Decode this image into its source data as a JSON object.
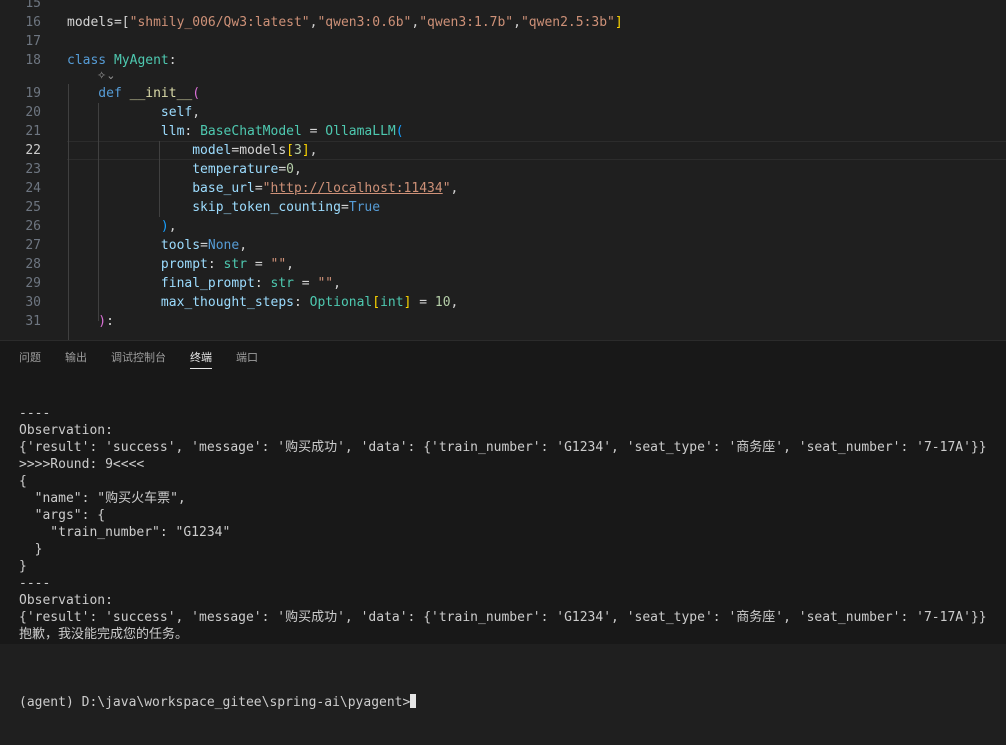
{
  "editor": {
    "lines": [
      {
        "num": "15",
        "tokens": []
      },
      {
        "num": "16",
        "tokens": [
          {
            "t": "models=[",
            "c": "w"
          },
          {
            "t": "\"shmily_006/Qw3:latest\"",
            "c": "s"
          },
          {
            "t": ",",
            "c": "w"
          },
          {
            "t": "\"qwen3:0.6b\"",
            "c": "s"
          },
          {
            "t": ",",
            "c": "w"
          },
          {
            "t": "\"qwen3:1.7b\"",
            "c": "s"
          },
          {
            "t": ",",
            "c": "w"
          },
          {
            "t": "\"qwen2.5:3b\"",
            "c": "s"
          },
          {
            "t": "]",
            "c": "br1"
          }
        ]
      },
      {
        "num": "17",
        "tokens": []
      },
      {
        "num": "18",
        "tokens": [
          {
            "t": "class ",
            "c": "k"
          },
          {
            "t": "MyAgent",
            "c": "cls"
          },
          {
            "t": ":",
            "c": "w"
          }
        ]
      },
      {
        "num": "19",
        "tokens": [
          {
            "t": "    def ",
            "c": "k"
          },
          {
            "t": "__init__",
            "c": "fn"
          },
          {
            "t": "(",
            "c": "br2"
          }
        ]
      },
      {
        "num": "20",
        "tokens": [
          {
            "t": "            self",
            "c": "p"
          },
          {
            "t": ",",
            "c": "w"
          }
        ]
      },
      {
        "num": "21",
        "tokens": [
          {
            "t": "            llm",
            "c": "p"
          },
          {
            "t": ": ",
            "c": "w"
          },
          {
            "t": "BaseChatModel",
            "c": "cls"
          },
          {
            "t": " = ",
            "c": "w"
          },
          {
            "t": "OllamaLLM",
            "c": "cls"
          },
          {
            "t": "(",
            "c": "br3"
          }
        ]
      },
      {
        "num": "22",
        "tokens": [
          {
            "t": "                model",
            "c": "p"
          },
          {
            "t": "=models",
            "c": "w"
          },
          {
            "t": "[",
            "c": "br1"
          },
          {
            "t": "3",
            "c": "n"
          },
          {
            "t": "]",
            "c": "br1"
          },
          {
            "t": ",",
            "c": "w"
          }
        ]
      },
      {
        "num": "23",
        "tokens": [
          {
            "t": "                temperature",
            "c": "p"
          },
          {
            "t": "=",
            "c": "w"
          },
          {
            "t": "0",
            "c": "n"
          },
          {
            "t": ",",
            "c": "w"
          }
        ]
      },
      {
        "num": "24",
        "tokens": [
          {
            "t": "                base_url",
            "c": "p"
          },
          {
            "t": "=",
            "c": "w"
          },
          {
            "t": "\"",
            "c": "s"
          },
          {
            "t": "http://localhost:11434",
            "c": "s url"
          },
          {
            "t": "\"",
            "c": "s"
          },
          {
            "t": ",",
            "c": "w"
          }
        ]
      },
      {
        "num": "25",
        "tokens": [
          {
            "t": "                skip_token_counting",
            "c": "p"
          },
          {
            "t": "=",
            "c": "w"
          },
          {
            "t": "True",
            "c": "k"
          }
        ]
      },
      {
        "num": "26",
        "tokens": [
          {
            "t": "            )",
            "c": "br3"
          },
          {
            "t": ",",
            "c": "w"
          }
        ]
      },
      {
        "num": "27",
        "tokens": [
          {
            "t": "            tools",
            "c": "p"
          },
          {
            "t": "=",
            "c": "w"
          },
          {
            "t": "None",
            "c": "k"
          },
          {
            "t": ",",
            "c": "w"
          }
        ]
      },
      {
        "num": "28",
        "tokens": [
          {
            "t": "            prompt",
            "c": "p"
          },
          {
            "t": ": ",
            "c": "w"
          },
          {
            "t": "str",
            "c": "cls"
          },
          {
            "t": " = ",
            "c": "w"
          },
          {
            "t": "\"\"",
            "c": "s"
          },
          {
            "t": ",",
            "c": "w"
          }
        ]
      },
      {
        "num": "29",
        "tokens": [
          {
            "t": "            final_prompt",
            "c": "p"
          },
          {
            "t": ": ",
            "c": "w"
          },
          {
            "t": "str",
            "c": "cls"
          },
          {
            "t": " = ",
            "c": "w"
          },
          {
            "t": "\"\"",
            "c": "s"
          },
          {
            "t": ",",
            "c": "w"
          }
        ]
      },
      {
        "num": "30",
        "tokens": [
          {
            "t": "            max_thought_steps",
            "c": "p"
          },
          {
            "t": ": ",
            "c": "w"
          },
          {
            "t": "Optional",
            "c": "cls"
          },
          {
            "t": "[",
            "c": "br1"
          },
          {
            "t": "int",
            "c": "cls"
          },
          {
            "t": "]",
            "c": "br1"
          },
          {
            "t": " = ",
            "c": "w"
          },
          {
            "t": "10",
            "c": "n"
          },
          {
            "t": ",",
            "c": "w"
          }
        ]
      },
      {
        "num": "31",
        "tokens": [
          {
            "t": "    )",
            "c": "br2"
          },
          {
            "t": ":",
            "c": "w"
          }
        ]
      }
    ],
    "current_line": "22",
    "codelens_icon": "ai-sparkle-icon"
  },
  "panel": {
    "tabs": [
      {
        "label": "问题",
        "active": false
      },
      {
        "label": "输出",
        "active": false
      },
      {
        "label": "调试控制台",
        "active": false
      },
      {
        "label": "终端",
        "active": true
      },
      {
        "label": "端口",
        "active": false
      }
    ],
    "terminal_lines": [
      "----",
      "Observation:",
      "{'result': 'success', 'message': '购买成功', 'data': {'train_number': 'G1234', 'seat_type': '商务座', 'seat_number': '7-17A'}}",
      ">>>>Round: 9<<<<",
      "{",
      "  \"name\": \"购买火车票\",",
      "  \"args\": {",
      "    \"train_number\": \"G1234\"",
      "  }",
      "}",
      "----",
      "Observation:",
      "{'result': 'success', 'message': '购买成功', 'data': {'train_number': 'G1234', 'seat_type': '商务座', 'seat_number': '7-17A'}}",
      "抱歉，我没能完成您的任务。",
      ""
    ],
    "prompt": "(agent) D:\\java\\workspace_gitee\\spring-ai\\pyagent>"
  }
}
